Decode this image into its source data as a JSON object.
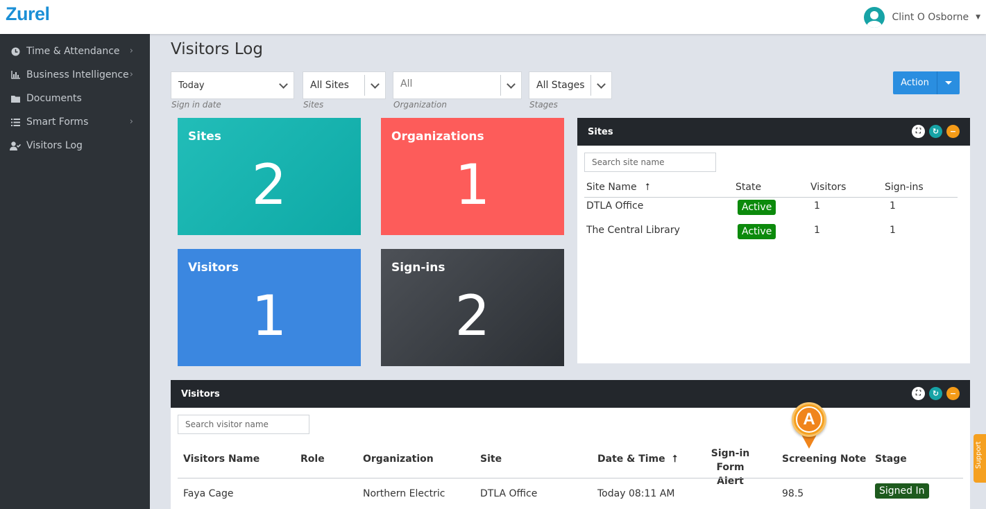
{
  "app": {
    "logo": "Zurel"
  },
  "user": {
    "name": "Clint O Osborne"
  },
  "sidebar": {
    "items": [
      {
        "label": "Time & Attendance",
        "icon": "clock-icon",
        "has_children": true
      },
      {
        "label": "Business Intelligence",
        "icon": "bar-chart-icon",
        "has_children": true
      },
      {
        "label": "Documents",
        "icon": "folder-icon",
        "has_children": false
      },
      {
        "label": "Smart Forms",
        "icon": "list-icon",
        "has_children": true
      },
      {
        "label": "Visitors Log",
        "icon": "user-check-icon",
        "has_children": false
      }
    ]
  },
  "page": {
    "title": "Visitors Log"
  },
  "filters": {
    "date": {
      "value": "Today",
      "label": "Sign in date"
    },
    "sites": {
      "value": "All Sites",
      "label": "Sites"
    },
    "organization": {
      "value": "All",
      "label": "Organization"
    },
    "stages": {
      "value": "All Stages",
      "label": "Stages"
    }
  },
  "action": {
    "label": "Action"
  },
  "tiles": {
    "sites": {
      "label": "Sites",
      "value": "2"
    },
    "organizations": {
      "label": "Organizations",
      "value": "1"
    },
    "visitors": {
      "label": "Visitors",
      "value": "1"
    },
    "signins": {
      "label": "Sign-ins",
      "value": "2"
    }
  },
  "sites_panel": {
    "title": "Sites",
    "search_placeholder": "Search site name",
    "columns": {
      "site_name": "Site Name",
      "sort_indicator": "⭡",
      "state": "State",
      "visitors": "Visitors",
      "signins": "Sign-ins"
    },
    "rows": [
      {
        "site_name": "DTLA Office",
        "state": "Active",
        "visitors": "1",
        "signins": "1"
      },
      {
        "site_name": "The Central Library",
        "state": "Active",
        "visitors": "1",
        "signins": "1"
      }
    ]
  },
  "visitors_panel": {
    "title": "Visitors",
    "search_placeholder": "Search visitor name",
    "columns": {
      "name": "Visitors Name",
      "role": "Role",
      "organization": "Organization",
      "site": "Site",
      "datetime": "Date & Time",
      "sort_indicator": "⭡",
      "alert_line1": "Sign-in Form",
      "alert_line2": "Alert",
      "screening": "Screening Note",
      "stage": "Stage"
    },
    "rows": [
      {
        "name": "Faya Cage",
        "role": "",
        "organization": "Northern Electric",
        "site": "DTLA Office",
        "datetime": "Today 08:11 AM",
        "alert": "",
        "screening": "98.5",
        "stage": "Signed In"
      }
    ]
  },
  "marker": {
    "letter": "A"
  },
  "support": {
    "label": "Support"
  },
  "colors": {
    "accent": "#2a8ee0",
    "sidebar_bg": "#2d3237",
    "tile_sites": "#1bb4b0",
    "tile_organizations": "#fd5c5a",
    "tile_visitors": "#3b87e0",
    "tile_signins": "#3f4349",
    "badge_active": "#0c8a0c"
  }
}
